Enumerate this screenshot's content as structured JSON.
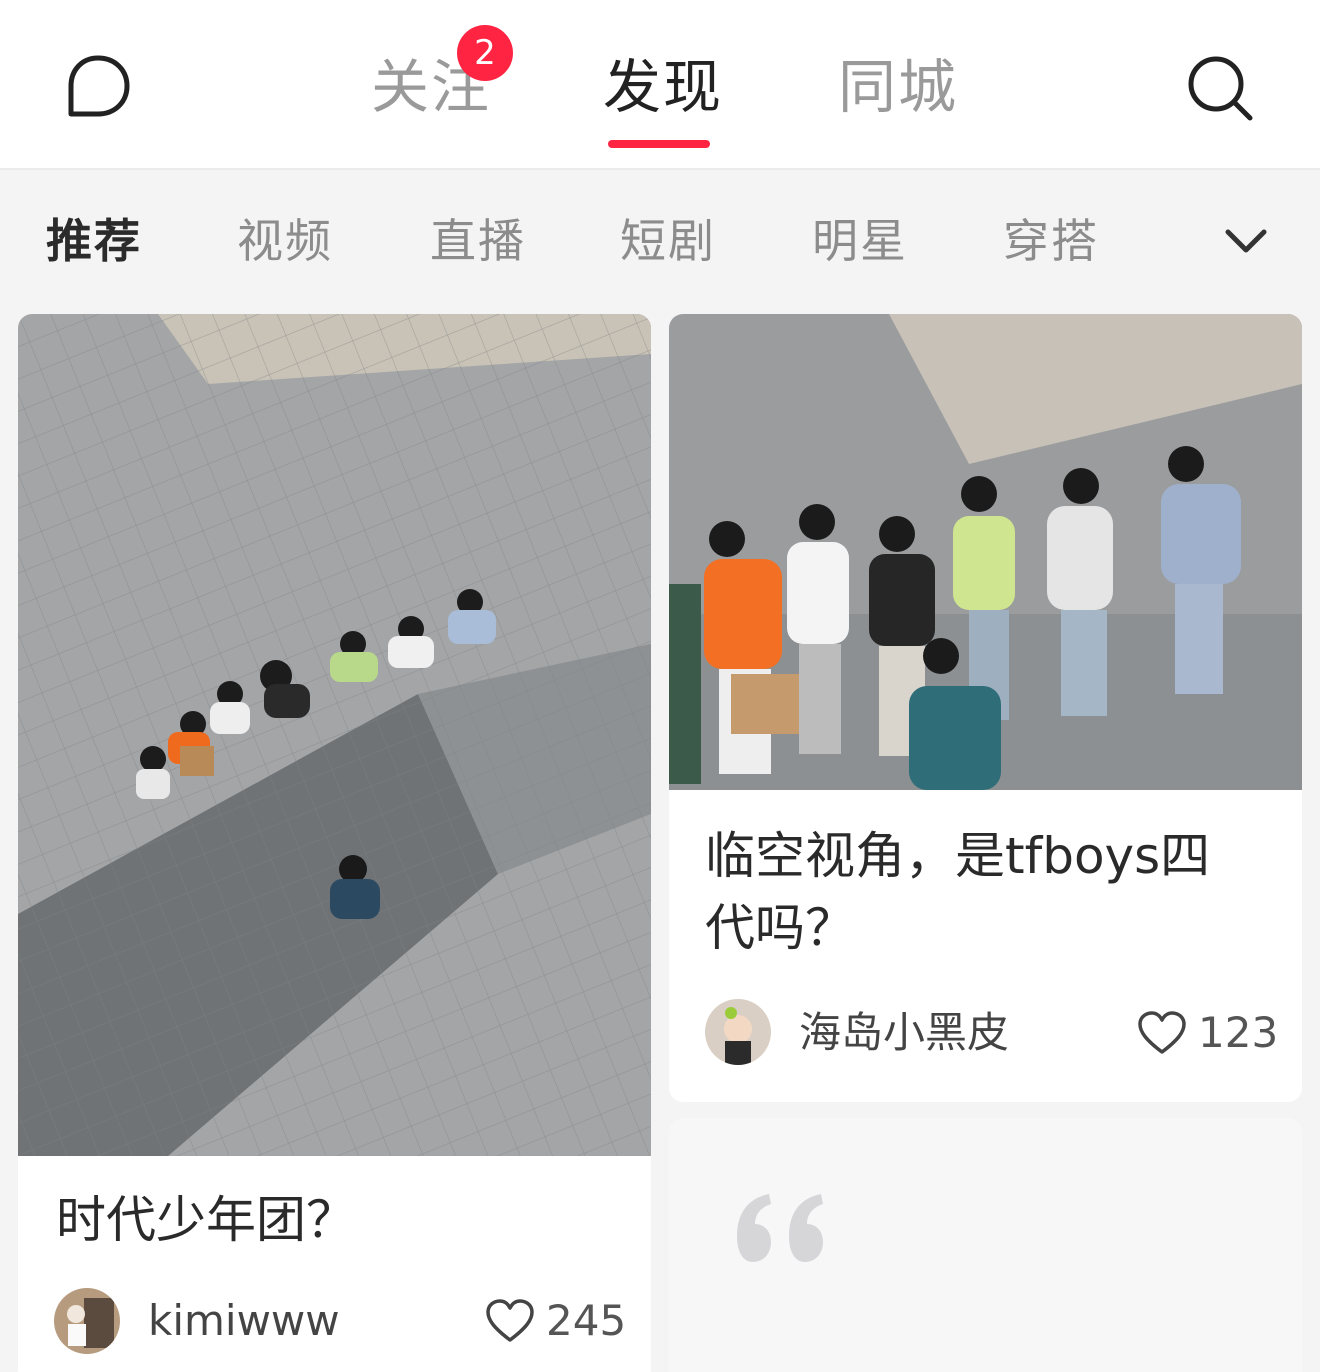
{
  "header": {
    "tabs": [
      {
        "label": "关注",
        "badge": "2"
      },
      {
        "label": "发现",
        "active": true
      },
      {
        "label": "同城"
      }
    ]
  },
  "categories": {
    "items": [
      "推荐",
      "视频",
      "直播",
      "短剧",
      "明星",
      "穿搭"
    ],
    "active": "推荐"
  },
  "feed": {
    "cards": [
      {
        "title": "时代少年团？",
        "author": "kimiwww",
        "likes": "245"
      },
      {
        "title_line1": "临空视角，是tfboys四",
        "title_line2": "代吗？",
        "author": "海岛小黑皮",
        "likes": "123"
      }
    ]
  },
  "colors": {
    "accent": "#ff2442",
    "background": "#f4f4f5",
    "card": "#ffffff"
  },
  "icons": {
    "message": "chat-bubble-icon",
    "search": "search-icon",
    "expand": "chevron-down-icon",
    "like": "heart-outline-icon",
    "quote": "quote-mark-icon"
  }
}
